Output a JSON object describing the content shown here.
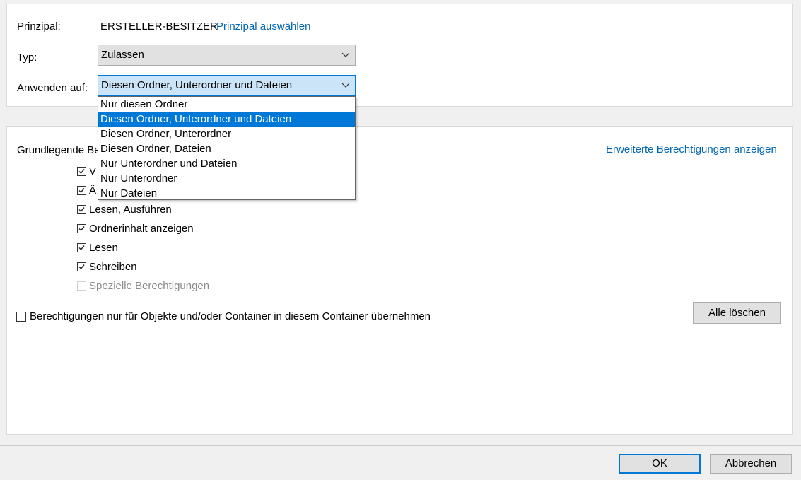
{
  "principal": {
    "label": "Prinzipal:",
    "value": "ERSTELLER-BESITZER",
    "select_link": "Prinzipal auswählen"
  },
  "type": {
    "label": "Typ:",
    "value": "Zulassen"
  },
  "apply_to": {
    "label": "Anwenden auf:",
    "value": "Diesen Ordner, Unterordner und Dateien",
    "options": [
      "Nur diesen Ordner",
      "Diesen Ordner, Unterordner und Dateien",
      "Diesen Ordner, Unterordner",
      "Diesen Ordner, Dateien",
      "Nur Unterordner und Dateien",
      "Nur Unterordner",
      "Nur Dateien"
    ],
    "selected_index": 1
  },
  "permissions": {
    "heading_visible": "Grundlegende Be",
    "advanced_link": "Erweiterte Berechtigungen anzeigen",
    "items": [
      {
        "label": "V",
        "checked": true,
        "disabled": false
      },
      {
        "label": "Ä",
        "checked": true,
        "disabled": false
      },
      {
        "label": "Lesen, Ausführen",
        "checked": true,
        "disabled": false
      },
      {
        "label": "Ordnerinhalt anzeigen",
        "checked": true,
        "disabled": false
      },
      {
        "label": "Lesen",
        "checked": true,
        "disabled": false
      },
      {
        "label": "Schreiben",
        "checked": true,
        "disabled": false
      },
      {
        "label": "Spezielle Berechtigungen",
        "checked": false,
        "disabled": true
      }
    ],
    "inherit_only": {
      "label": "Berechtigungen nur für Objekte und/oder Container in diesem Container übernehmen",
      "checked": false
    },
    "clear_all": "Alle löschen"
  },
  "footer": {
    "ok": "OK",
    "cancel": "Abbrechen"
  },
  "colors": {
    "accent": "#0078d7",
    "link": "#0066b4",
    "dialog_bg": "#f0f0f0"
  }
}
